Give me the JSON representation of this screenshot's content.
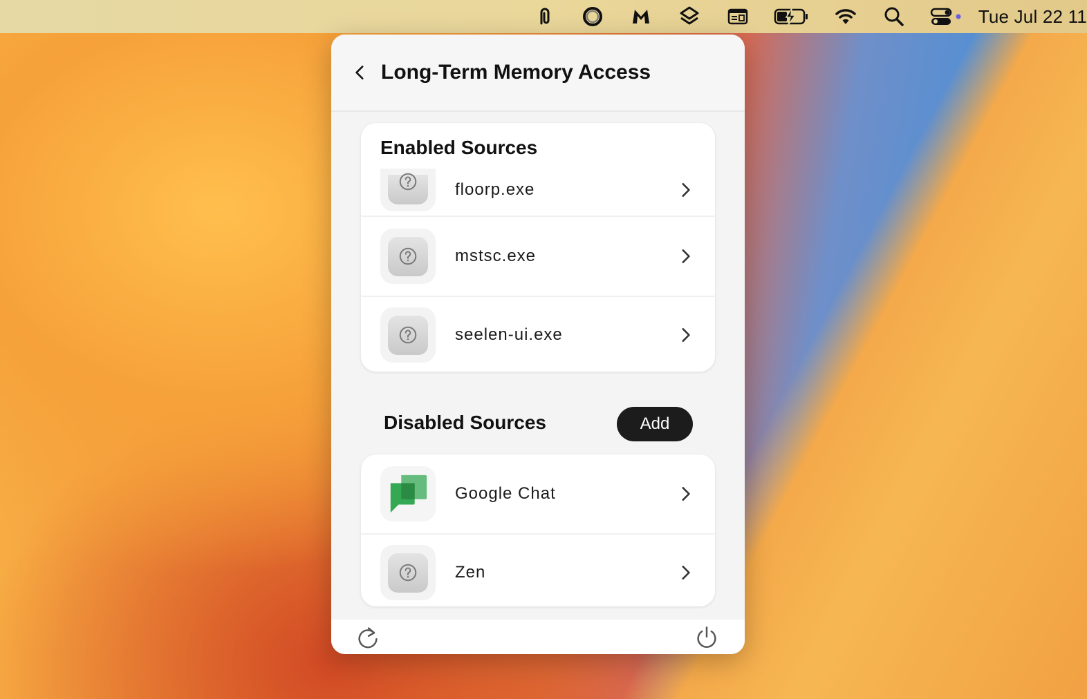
{
  "menubar": {
    "icons": [
      "paperclip-app-icon",
      "ring-app-icon",
      "malwarebytes-icon",
      "layers-app-icon",
      "keyboard-shortcut-icon",
      "battery-charging-icon",
      "wifi-icon",
      "search-icon",
      "control-center-icon"
    ],
    "clock": "Tue Jul 22  11"
  },
  "panel": {
    "title": "Long-Term Memory Access",
    "enabled": {
      "title": "Enabled Sources",
      "items": [
        {
          "label": "floorp.exe",
          "icon": "unknown-app-icon"
        },
        {
          "label": "mstsc.exe",
          "icon": "unknown-app-icon"
        },
        {
          "label": "seelen-ui.exe",
          "icon": "unknown-app-icon"
        }
      ]
    },
    "disabled": {
      "title": "Disabled Sources",
      "add_label": "Add",
      "items": [
        {
          "label": "Google Chat",
          "icon": "google-chat-icon"
        },
        {
          "label": "Zen",
          "icon": "unknown-app-icon"
        }
      ]
    },
    "footer": {
      "left_icon": "refresh-icon",
      "right_icon": "power-icon"
    }
  },
  "colors": {
    "accent_button": "#1c1c1c",
    "google_chat_green": "#34a853"
  }
}
